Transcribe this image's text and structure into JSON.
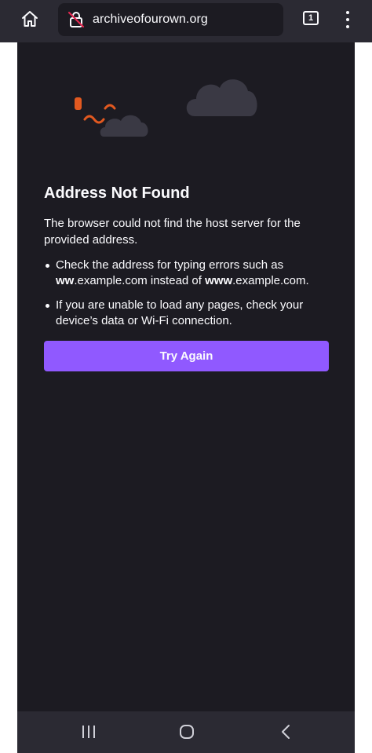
{
  "browser": {
    "url": "archiveofourown.org",
    "tab_count": "1"
  },
  "error_page": {
    "title": "Address Not Found",
    "description": "The browser could not find the host server for the provided address.",
    "bullets": [
      {
        "prefix": "Check the address for typing errors such as ",
        "bold1": "ww",
        "mid": ".example.com instead of ",
        "bold2": "www",
        "suffix": ".example.com."
      },
      {
        "text": "If you are unable to load any pages, check your device’s data or Wi-Fi connection."
      }
    ],
    "button_label": "Try Again"
  },
  "icons": {
    "home": "home-icon",
    "insecure": "insecure-lock-icon",
    "tabs": "tabs-counter-icon",
    "menu": "more-vert-icon",
    "nav_recents": "recent-apps-icon",
    "nav_home": "system-home-icon",
    "nav_back": "back-icon"
  },
  "colors": {
    "page_bg": "#1c1b22",
    "toolbar_bg": "#2b2a33",
    "accent": "#9059ff",
    "illustration_orange": "#e25920",
    "cloud": "#3a3944"
  }
}
